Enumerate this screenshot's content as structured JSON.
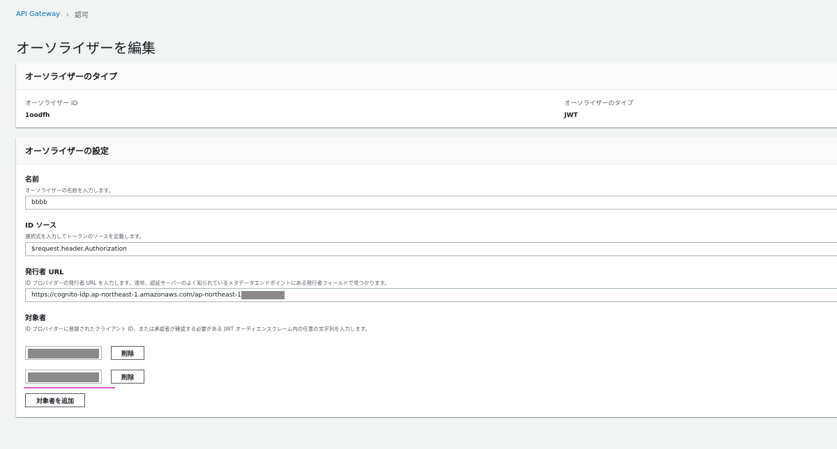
{
  "breadcrumb": {
    "parent": "API Gateway",
    "separator": "›",
    "current": "認可"
  },
  "page": {
    "title": "オーソライザーを編集"
  },
  "type_panel": {
    "header": "オーソライザーのタイプ",
    "id_label": "オーソライザー ID",
    "id_value": "1oodfh",
    "type_label": "オーソライザーのタイプ",
    "type_value": "JWT"
  },
  "settings_panel": {
    "header": "オーソライザーの設定",
    "name": {
      "label": "名前",
      "description": "オーソライザーの名前を入力します。",
      "value": "bbbb"
    },
    "identity_source": {
      "label": "ID ソース",
      "description": "選択式を入力してトークンのソースを定義します。",
      "value": "$request.header.Authorization"
    },
    "issuer_url": {
      "label": "発行者 URL",
      "description": "ID プロバイダーの発行者 URL を入力します。通常、認証サーバーのよく知られているメタデータエンドポイントにある発行者フィールドで見つかります。",
      "value": "https://cognito-idp.ap-northeast-1.amazonaws.com/ap-northeast-1"
    },
    "audience": {
      "label": "対象者",
      "description": "ID プロバイダーに登録されたクライアント ID、または承認者が確認する必要がある JWT オーディエンスクレーム内の任意の文字列を入力します。",
      "remove_label": "削除",
      "add_label": "対象者を追加"
    }
  }
}
